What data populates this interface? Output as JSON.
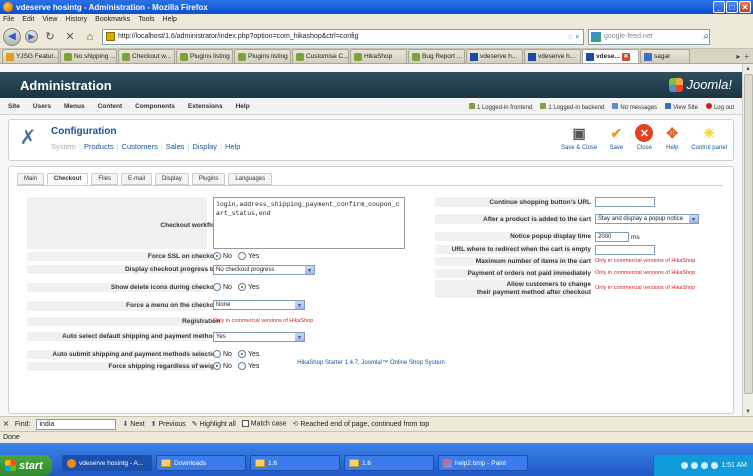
{
  "window": {
    "title": "vdeserve hosintg - Administration - Mozilla Firefox",
    "buttons": [
      "_",
      "□",
      "✕"
    ]
  },
  "menubar": [
    "File",
    "Edit",
    "View",
    "History",
    "Bookmarks",
    "Tools",
    "Help"
  ],
  "nav": {
    "url": "http://localhost/1.6/administrator/index.php?option=com_hikashop&ctrl=config",
    "search_placeholder": "google-feed.net"
  },
  "tabs": [
    {
      "label": "YJSG Featur...",
      "icon": "joomla"
    },
    {
      "label": "No shipping ...",
      "icon": "puzzle"
    },
    {
      "label": "Checkout w...",
      "icon": "puzzle"
    },
    {
      "label": "Plugins listing",
      "icon": "puzzle"
    },
    {
      "label": "Plugins listing",
      "icon": "puzzle"
    },
    {
      "label": "Customise C...",
      "icon": "puzzle"
    },
    {
      "label": "HikaShop",
      "icon": "puzzle"
    },
    {
      "label": "Bug Report ...",
      "icon": "puzzle"
    },
    {
      "label": "vdeserve h...",
      "icon": "x"
    },
    {
      "label": "vdeserve h...",
      "icon": "x"
    },
    {
      "label": "vdese...",
      "icon": "x",
      "active": true
    },
    {
      "label": "sagar",
      "icon": "g"
    }
  ],
  "joomla": {
    "header_title": "Administration",
    "logo_text": "Joomla!",
    "menu": [
      "Site",
      "Users",
      "Menus",
      "Content",
      "Components",
      "Extensions",
      "Help"
    ],
    "status": [
      "1 Logged-in frontend",
      "1 Logged-in backend",
      "No messages",
      "View Site",
      "Log out"
    ]
  },
  "config": {
    "title": "Configuration",
    "subnav": [
      "System",
      "Products",
      "Customers",
      "Sales",
      "Display",
      "Help"
    ],
    "toolbar": [
      "Save & Close",
      "Save",
      "Close",
      "Help",
      "Control panel"
    ],
    "subtabs": [
      "Main",
      "Checkout",
      "Files",
      "E-mail",
      "Display",
      "Plugins",
      "Languages"
    ],
    "active_subtab": "Checkout"
  },
  "left": {
    "workflow_label": "Checkout workflow",
    "workflow_value": "login,address_shipping_payment_confirm_coupon_cart_status,end",
    "force_ssl_label": "Force SSL on checkout",
    "progress_label": "Display checkout progress bar",
    "progress_value": "No checkout progress",
    "delete_icons_label": "Show delete icons during checkout",
    "force_menu_label": "Force a menu on the checkout",
    "force_menu_value": "None",
    "registration_label": "Registration",
    "registration_value": "Only in commercial versions of HikaShop",
    "auto_select_label": "Auto select default shipping and payment methods",
    "auto_select_value": "Yes",
    "auto_submit_label": "Auto submit shipping and payment methods selection",
    "force_shipping_label": "Force shipping regardless of weight",
    "no": "No",
    "yes": "Yes"
  },
  "right": {
    "continue_url_label": "Continue shopping button's URL",
    "after_added_label": "After a product is added to the cart",
    "after_added_value": "Stay and display a popup notice",
    "popup_time_label": "Notice popup display time",
    "popup_time_value": "2000",
    "popup_time_unit": "ms",
    "redirect_label": "URL where to redirect when the cart is empty",
    "max_items_label": "Maximum number of items in the cart",
    "max_items_value": "Only in commercial versions of HikaShop",
    "unpaid_label": "Payment of orders not paid immediately",
    "unpaid_value": "Only in commercial versions of HikaShop",
    "allow_change_label_1": "Allow customers to change",
    "allow_change_label_2": "their payment method after checkout",
    "allow_change_value": "Only in commercial versions of HikaShop"
  },
  "footer": "HikaShop Starter 1.4.7, Joomla!™ Online Shop System",
  "findbar": {
    "label": "Find:",
    "value": "india",
    "next": "Next",
    "previous": "Previous",
    "highlight": "Highlight all",
    "match_case": "Match case",
    "message": "Reached end of page, continued from top"
  },
  "status": "Done",
  "taskbar": {
    "start": "start",
    "tasks": [
      "vdeserve hosintg - A...",
      "Downloads",
      "1.6",
      "1.6",
      "help2.bmp - Paint"
    ],
    "time": "1:51 AM"
  }
}
